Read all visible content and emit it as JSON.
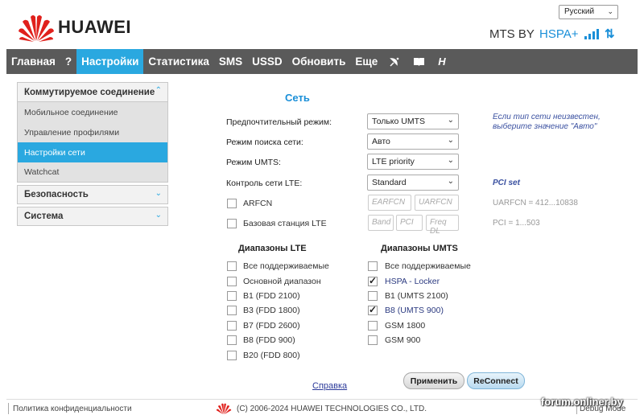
{
  "header": {
    "brand": "HUAWEI",
    "language": "Русский",
    "operator": "MTS BY",
    "network_type": "HSPA+",
    "traffic_icon": "updown-arrows-icon"
  },
  "nav": {
    "items": [
      {
        "label": "Главная"
      },
      {
        "label": "?"
      },
      {
        "label": "Настройки",
        "active": true
      },
      {
        "label": "Статистика"
      },
      {
        "label": "SMS"
      },
      {
        "label": "USSD"
      },
      {
        "label": "Обновить"
      },
      {
        "label": "Еще"
      }
    ],
    "icon_h": "H"
  },
  "sidebar": {
    "group1": "Коммутируемое соединение",
    "sub1": "Мобильное соединение",
    "sub2": "Управление профилями",
    "sub3": "Настройки сети",
    "sub4": "Watchcat",
    "group2": "Безопасность",
    "group3": "Система"
  },
  "main": {
    "title": "Сеть",
    "pref_mode_label": "Предпочтительный режим:",
    "pref_mode_value": "Только UMTS",
    "search_mode_label": "Режим поиска сети:",
    "search_mode_value": "Авто",
    "umts_mode_label": "Режим UMTS:",
    "umts_mode_value": "LTE priority",
    "lte_control_label": "Контроль сети LTE:",
    "lte_control_value": "Standard",
    "hint_network": "Если тип сети неизвестен, выберите значение \"Авто\"",
    "pci_set": "PCI set",
    "arfcn_label": "ARFCN",
    "earfcn_placeholder": "EARFCN",
    "uarfcn_placeholder": "UARFCN",
    "uarfcn_hint": "UARFCN = 412...10838",
    "bs_label": "Базовая станция LTE",
    "band_placeholder": "Band",
    "pci_placeholder": "PCI",
    "freq_placeholder": "Freq DL",
    "pci_hint": "PCI = 1...503",
    "lte_bands_head": "Диапазоны LTE",
    "umts_bands_head": "Диапазоны UMTS",
    "lte_bands": [
      "Все поддерживаемые",
      "Основной диапазон",
      "B1 (FDD 2100)",
      "B3 (FDD 1800)",
      "B7 (FDD 2600)",
      "B8 (FDD 900)",
      "B20 (FDD 800)"
    ],
    "umts_bands": [
      "Все поддерживаемые",
      "HSPA - Locker",
      "B1 (UMTS 2100)",
      "B8 (UMTS 900)",
      "GSM 1800",
      "GSM 900"
    ],
    "help": "Справка",
    "apply": "Применить",
    "reconnect": "ReConnect"
  },
  "footer": {
    "privacy": "Политика конфиденциальности",
    "copyright": "(C) 2006-2024 HUAWEI TECHNOLOGIES CO., LTD.",
    "debug": "Debug Mode"
  },
  "watermark": "forum.onliner.by",
  "colors": {
    "accent": "#2aa8e0",
    "nav_bg": "#5a5a5a",
    "brand_red": "#e0201c"
  }
}
